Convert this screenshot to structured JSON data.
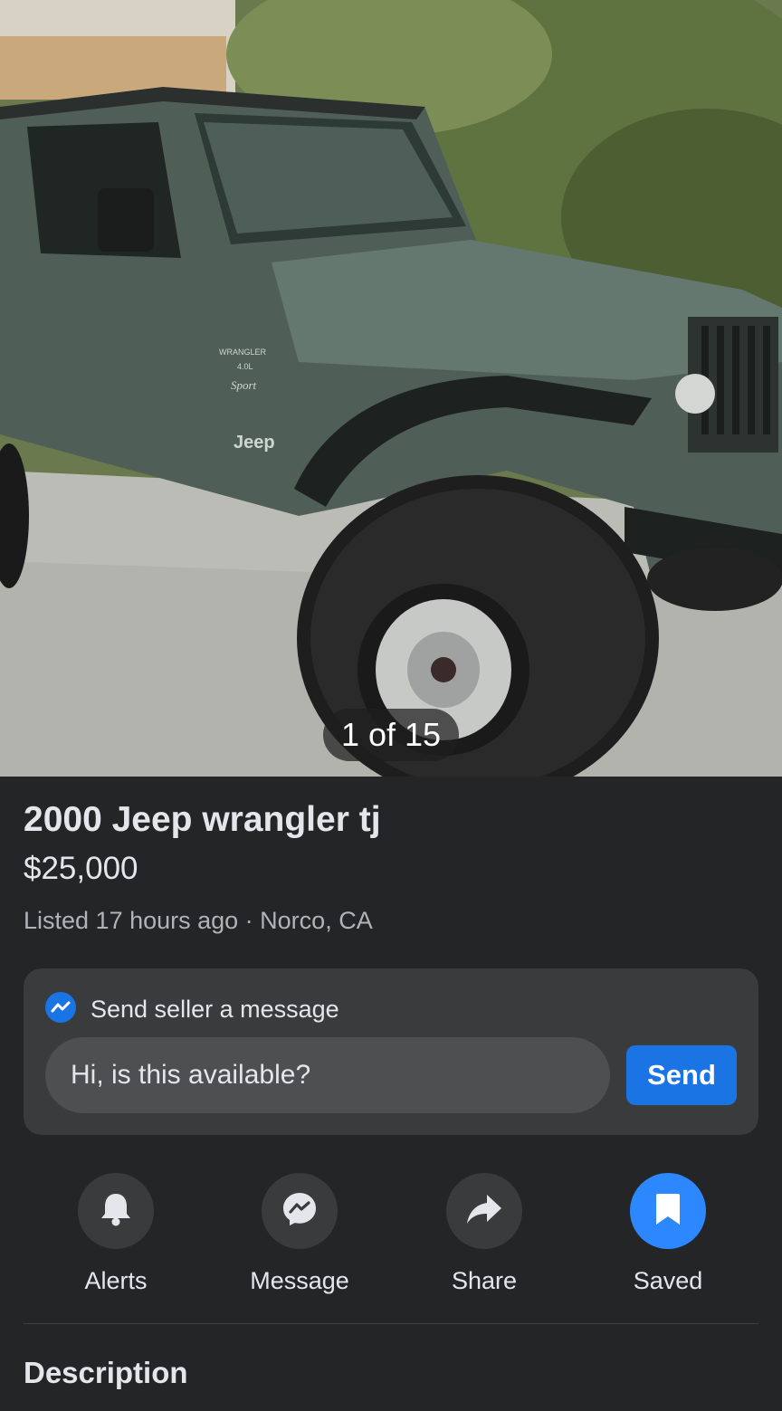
{
  "listing": {
    "photo_counter": "1 of 15",
    "title": "2000 Jeep wrangler tj",
    "price": "$25,000",
    "meta": "Listed 17 hours ago · Norco, CA"
  },
  "message_card": {
    "heading": "Send seller a message",
    "input_value": "Hi, is this available?",
    "send_label": "Send"
  },
  "actions": [
    {
      "label": "Alerts",
      "icon": "bell-icon"
    },
    {
      "label": "Message",
      "icon": "messenger-icon"
    },
    {
      "label": "Share",
      "icon": "share-icon"
    },
    {
      "label": "Saved",
      "icon": "bookmark-icon",
      "active": true
    }
  ],
  "section": {
    "description_title": "Description"
  },
  "colors": {
    "background": "#242526",
    "card": "#3a3b3c",
    "accent": "#1b74e4",
    "saved_active": "#2d88ff"
  }
}
